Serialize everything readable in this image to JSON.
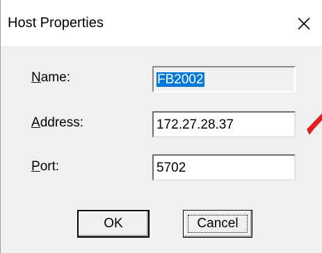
{
  "window": {
    "title": "Host Properties",
    "close_icon": "close-icon"
  },
  "form": {
    "name": {
      "label_mnemonic": "N",
      "label_rest": "ame:",
      "value": "FB2002",
      "readonly": true,
      "selected": true
    },
    "address": {
      "label_mnemonic": "A",
      "label_rest": "ddress:",
      "value": "172.27.28.37"
    },
    "port": {
      "label_mnemonic": "P",
      "label_rest": "ort:",
      "value": "5702"
    }
  },
  "buttons": {
    "ok_label": "OK",
    "cancel_label": "Cancel"
  },
  "annotation": {
    "icon": "red-arrow-icon",
    "color": "#e02020"
  },
  "colors": {
    "dialog_bg": "#f0f0f0",
    "selection": "#0078d7"
  }
}
